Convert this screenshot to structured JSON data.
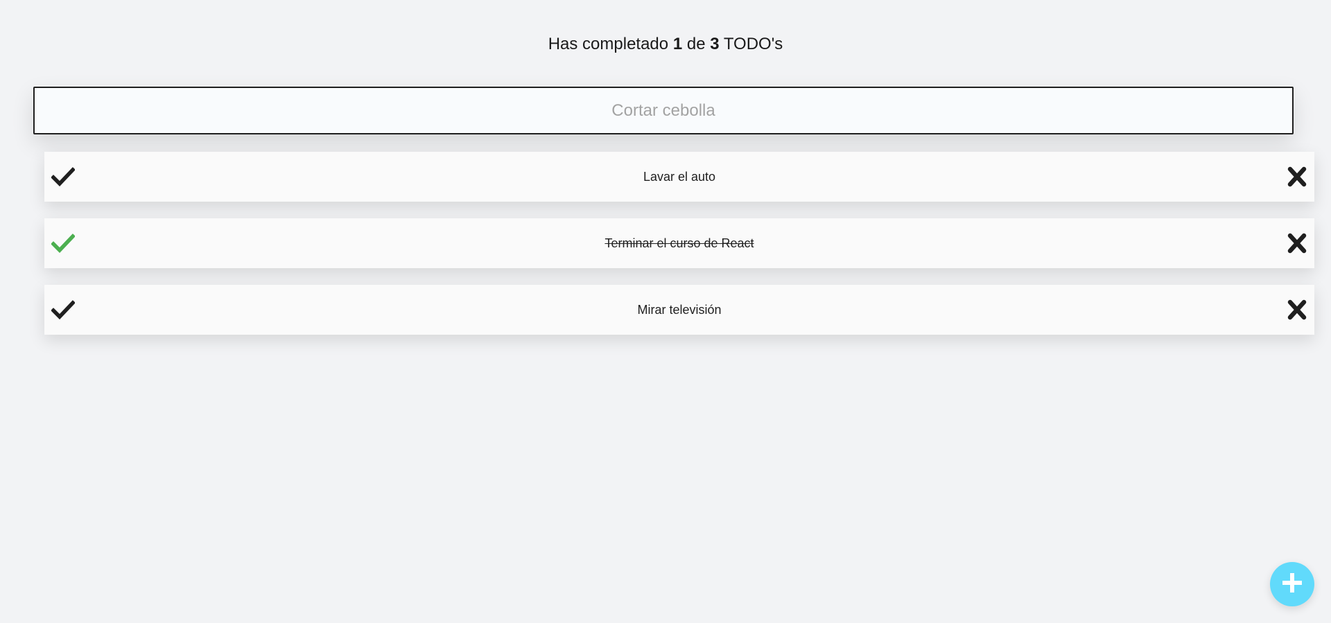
{
  "counter": {
    "prefix": "Has completado",
    "completed": "1",
    "middle": "de",
    "total": "3",
    "suffix": "TODO's"
  },
  "search": {
    "placeholder": "Cortar cebolla",
    "value": ""
  },
  "todos": [
    {
      "text": "Lavar el auto",
      "completed": false
    },
    {
      "text": "Terminar el curso de React",
      "completed": true
    },
    {
      "text": "Mirar televisión",
      "completed": false
    }
  ],
  "colors": {
    "background": "#f2f3f5",
    "check_default": "#1f1f1f",
    "check_done": "#4caf50",
    "delete": "#1f1f1f",
    "add_button": "#61dafb",
    "add_icon": "#ffffff"
  },
  "icons": {
    "check": "check-icon",
    "delete": "close-icon",
    "add": "plus-icon"
  }
}
